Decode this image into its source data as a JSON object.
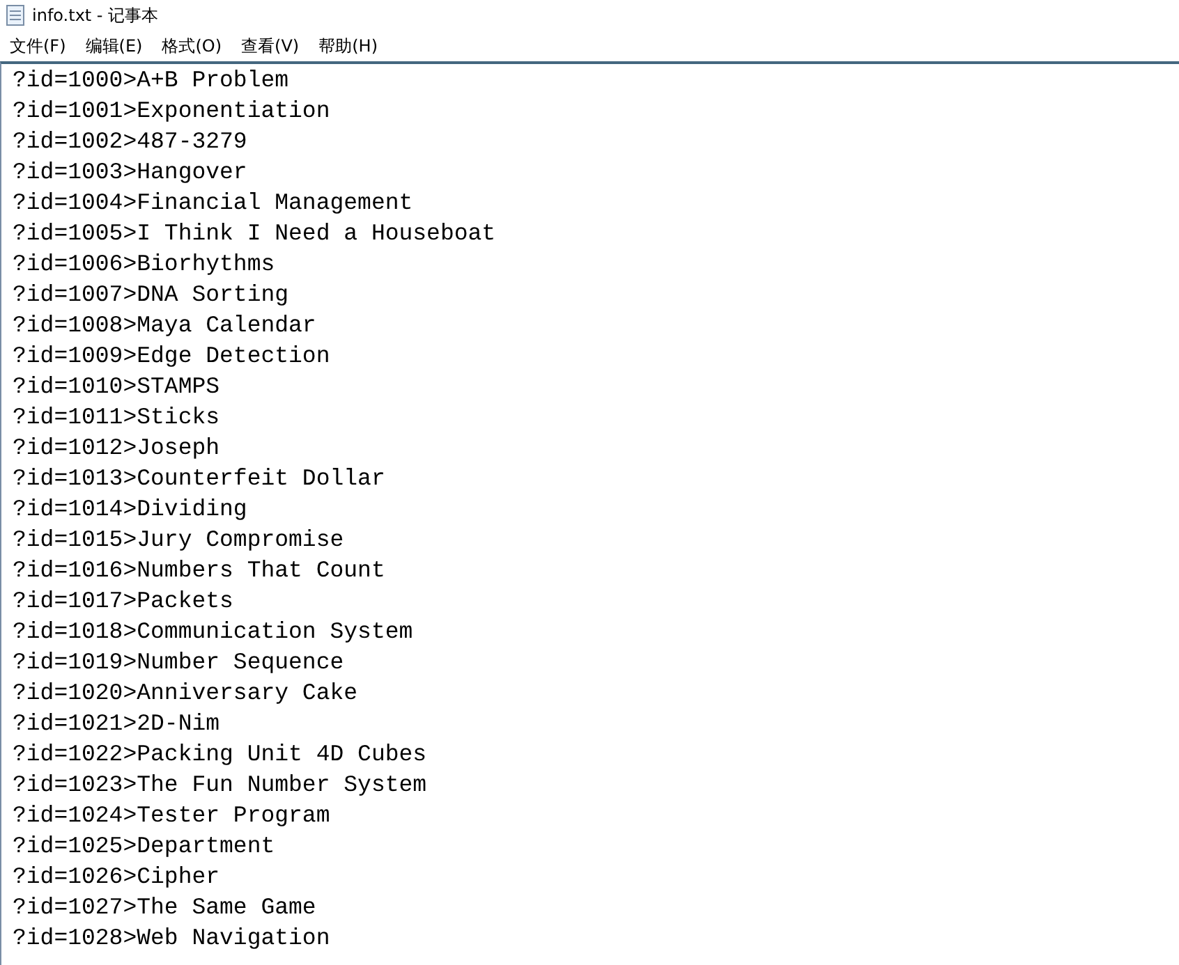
{
  "window": {
    "title": "info.txt - 记事本"
  },
  "menu": [
    "文件(F)",
    "编辑(E)",
    "格式(O)",
    "查看(V)",
    "帮助(H)"
  ],
  "lines": [
    "?id=1000>A+B Problem",
    "?id=1001>Exponentiation",
    "?id=1002>487-3279",
    "?id=1003>Hangover",
    "?id=1004>Financial Management",
    "?id=1005>I Think I Need a Houseboat",
    "?id=1006>Biorhythms",
    "?id=1007>DNA Sorting",
    "?id=1008>Maya Calendar",
    "?id=1009>Edge Detection",
    "?id=1010>STAMPS",
    "?id=1011>Sticks",
    "?id=1012>Joseph",
    "?id=1013>Counterfeit Dollar",
    "?id=1014>Dividing",
    "?id=1015>Jury Compromise",
    "?id=1016>Numbers That Count",
    "?id=1017>Packets",
    "?id=1018>Communication System",
    "?id=1019>Number Sequence",
    "?id=1020>Anniversary Cake",
    "?id=1021>2D-Nim",
    "?id=1022>Packing Unit 4D Cubes",
    "?id=1023>The Fun Number System",
    "?id=1024>Tester Program",
    "?id=1025>Department",
    "?id=1026>Cipher",
    "?id=1027>The Same Game",
    "?id=1028>Web Navigation"
  ]
}
